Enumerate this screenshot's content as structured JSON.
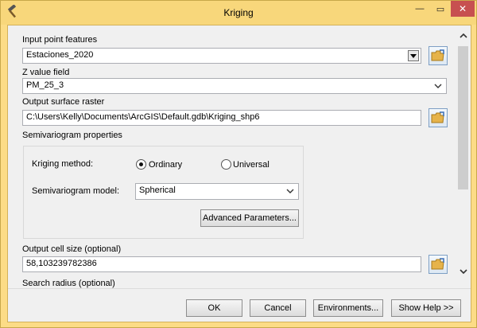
{
  "window": {
    "title": "Kriging",
    "controls": {
      "minimize": "—",
      "maximize": "▭",
      "close": "✕"
    }
  },
  "form": {
    "input_features": {
      "label": "Input point features",
      "value": "Estaciones_2020"
    },
    "z_field": {
      "label": "Z value field",
      "value": "PM_25_3"
    },
    "output_raster": {
      "label": "Output surface raster",
      "value": "C:\\Users\\Kelly\\Documents\\ArcGIS\\Default.gdb\\Kriging_shp6"
    },
    "semivariogram": {
      "section_label": "Semivariogram properties",
      "method_label": "Kriging method:",
      "method_options": [
        "Ordinary",
        "Universal"
      ],
      "method_selected": "Ordinary",
      "model_label": "Semivariogram model:",
      "model_value": "Spherical",
      "advanced_button": "Advanced Parameters..."
    },
    "cell_size": {
      "label": "Output cell size (optional)",
      "value": "58,103239782386"
    },
    "search_radius": {
      "label": "Search radius (optional)"
    }
  },
  "footer": {
    "ok": "OK",
    "cancel": "Cancel",
    "environments": "Environments...",
    "show_help": "Show Help >>"
  },
  "icons": {
    "app": "hammer-icon",
    "browse": "open-folder-icon"
  }
}
